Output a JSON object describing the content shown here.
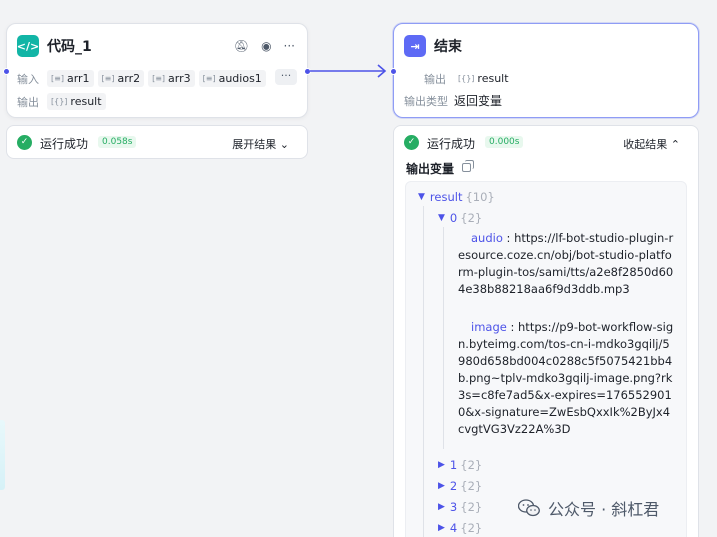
{
  "code_node": {
    "title": "代码_1",
    "input_label": "输入",
    "inputs": [
      "arr1",
      "arr2",
      "arr3",
      "audios1"
    ],
    "more": "···",
    "output_label": "输出",
    "output": "result",
    "status_text": "运行成功",
    "time": "0.058s",
    "toggle_label": "展开结果 ⌄"
  },
  "end_node": {
    "title": "结束",
    "output_label": "输出",
    "output": "result",
    "output_type_label": "输出类型",
    "output_type": "返回变量",
    "status_text": "运行成功",
    "time": "0.000s",
    "toggle_label": "收起结果 ⌃",
    "output_var_title": "输出变量"
  },
  "tree": {
    "root_key": "result",
    "root_count": "{10}",
    "item0_key": "0",
    "item0_count": "{2}",
    "audio_key": "audio",
    "audio_value": "https://lf-bot-studio-plugin-resource.coze.cn/obj/bot-studio-platform-plugin-tos/sami/tts/a2e8f2850d604e38b88218aa6f9d3ddb.mp3",
    "image_key": "image",
    "image_value": "https://p9-bot-workflow-sign.byteimg.com/tos-cn-i-mdko3gqilj/5980d658bd004c0288c5f5075421bb4b.png~tplv-mdko3gqilj-image.png?rk3s=c8fe7ad5&x-expires=1765529010&x-signature=ZwEsbQxxIk%2ByJx4cvgtVG3Vz22A%3D",
    "collapsed": [
      {
        "key": "1",
        "count": "{2}"
      },
      {
        "key": "2",
        "count": "{2}"
      },
      {
        "key": "3",
        "count": "{2}"
      },
      {
        "key": "4",
        "count": "{2}"
      }
    ]
  },
  "watermark": "公众号 · 斜杠君",
  "colors": {
    "accent": "#4d53e8",
    "success": "#26ad63",
    "code_icon": "#12b5a6",
    "end_icon": "#5e6af5"
  },
  "icons": {
    "code_node": "code-brackets-icon",
    "end_node": "exit-icon",
    "success": "check-circle-icon"
  }
}
